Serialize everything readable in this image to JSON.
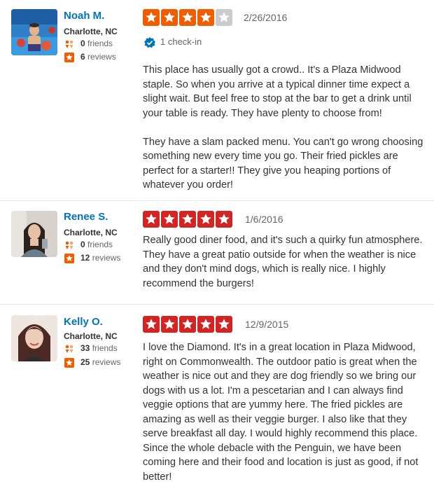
{
  "colors": {
    "star_red": "#d32323",
    "star_orange": "#f15c00",
    "star_empty": "#cccccc",
    "name_link": "#0073bb",
    "friends_icon": "#f15c00",
    "reviews_icon": "#f15c00",
    "checkin_icon": "#0073bb"
  },
  "reviews": [
    {
      "user": {
        "name": "Noah M.",
        "location": "Charlotte, NC",
        "friends_count": "0",
        "friends_label": "friends",
        "reviews_count": "6",
        "reviews_label": "reviews",
        "avatar_icon": "user-photo-pool"
      },
      "rating": 4,
      "rating_max": 5,
      "date": "2/26/2016",
      "checkin_text": "1 check-in",
      "text": "This place has usually got a crowd.. It's a Plaza Midwood staple. So when you arrive at a typical dinner time expect a slight wait. But feel free to stop at the bar to get a drink until your table is ready. They have plenty to choose from!\n\nThey have a slam packed menu. You can't go wrong choosing something new every time you go. Their fried pickles are perfect for a starter!! They give you heaping portions of whatever you order!"
    },
    {
      "user": {
        "name": "Renee S.",
        "location": "Charlotte, NC",
        "friends_count": "0",
        "friends_label": "friends",
        "reviews_count": "12",
        "reviews_label": "reviews",
        "avatar_icon": "user-photo-selfie"
      },
      "rating": 5,
      "rating_max": 5,
      "date": "1/6/2016",
      "text": "Really good diner food, and it's such a quirky fun atmosphere. They have a great patio outside for when the weather is nice and they don't mind dogs, which is really nice. I highly recommend the burgers!"
    },
    {
      "user": {
        "name": "Kelly O.",
        "location": "Charlotte, NC",
        "friends_count": "33",
        "friends_label": "friends",
        "reviews_count": "25",
        "reviews_label": "reviews",
        "avatar_icon": "user-photo-portrait"
      },
      "rating": 5,
      "rating_max": 5,
      "date": "12/9/2015",
      "text": "I love the Diamond.  It's in a great location in Plaza Midwood, right on Commonwealth.  The outdoor patio is great when the weather is nice out and they are dog friendly so we bring our dogs with us a lot.  I'm a pescetarian and I can always find veggie options that are yummy here. The fried pickles are amazing as well as their veggie burger.  I also like that they serve breakfast all day.  I would highly recommend this place.  Since the whole debacle with the Penguin, we have been coming here and their food and location is just as good, if not better!"
    }
  ]
}
